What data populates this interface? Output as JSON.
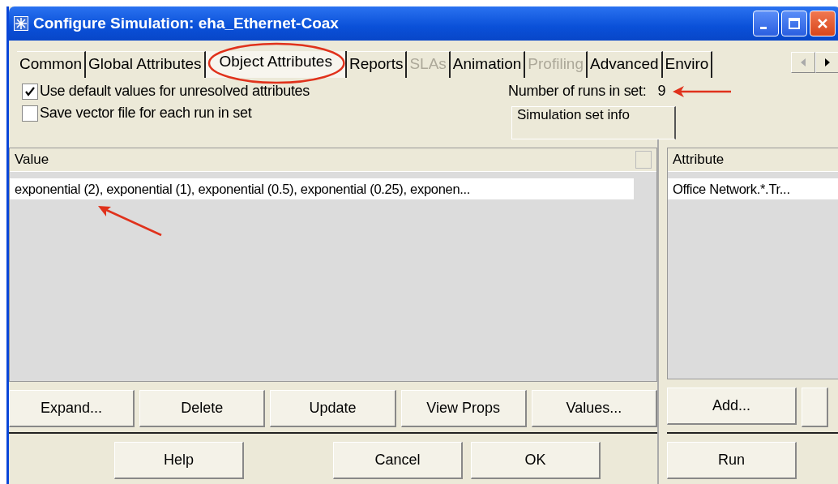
{
  "window": {
    "title": "Configure Simulation: eha_Ethernet-Coax"
  },
  "tabs": [
    {
      "label": "Common",
      "selected": false,
      "disabled": false
    },
    {
      "label": "Global Attributes",
      "selected": false,
      "disabled": false
    },
    {
      "label": "Object Attributes",
      "selected": true,
      "disabled": false
    },
    {
      "label": "Reports",
      "selected": false,
      "disabled": false
    },
    {
      "label": "SLAs",
      "selected": false,
      "disabled": true
    },
    {
      "label": "Animation",
      "selected": false,
      "disabled": false
    },
    {
      "label": "Profiling",
      "selected": false,
      "disabled": true
    },
    {
      "label": "Advanced",
      "selected": false,
      "disabled": false
    },
    {
      "label": "Enviro",
      "selected": false,
      "disabled": false
    }
  ],
  "options": [
    {
      "label": "Use default values for unresolved attributes",
      "checked": true
    },
    {
      "label": "Save vector file for each run in set",
      "checked": false
    }
  ],
  "runs": {
    "label": "Number of runs in set:",
    "value": "9"
  },
  "group_box": {
    "label": "Simulation set info"
  },
  "value_table": {
    "columns": [
      "Value"
    ],
    "rows": [
      {
        "cells": [
          "exponential (2), exponential (1), exponential (0.5), exponential (0.25), exponen..."
        ],
        "selected": false
      }
    ]
  },
  "value_buttons": [
    "Expand...",
    "Delete",
    "Update",
    "View Props",
    "Values..."
  ],
  "attribute_table": {
    "columns": [
      "Attribute"
    ],
    "rows": [
      {
        "cells": [
          "Office Network.*.Tr..."
        ],
        "selected": false
      }
    ]
  },
  "attribute_buttons": [
    "Add..."
  ],
  "dialog_buttons": [
    "Help",
    "Cancel",
    "OK"
  ],
  "run_button": "Run"
}
